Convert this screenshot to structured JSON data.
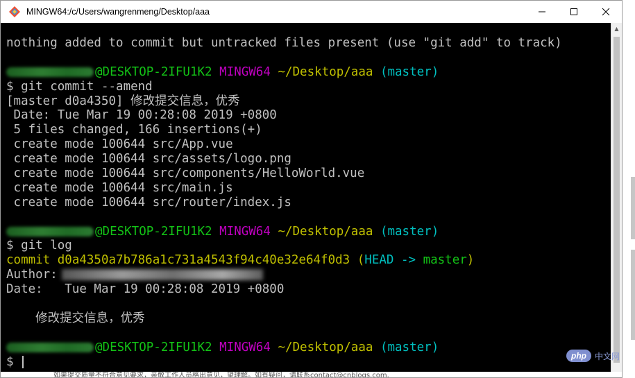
{
  "window": {
    "title": "MINGW64:/c/Users/wangrenmeng/Desktop/aaa"
  },
  "colors": {
    "host": "#13c216",
    "shell": "#c000c0",
    "path": "#c0c000",
    "branch": "#00c0c0",
    "text": "#c0c0c0",
    "commit": "#c0c000",
    "head": "#00c0c0",
    "master_ref": "#13c216"
  },
  "terminal": {
    "line1": "nothing added to commit but untracked files present (use \"git add\" to track)",
    "prompt": {
      "host": "@DESKTOP-2IFU1K2",
      "shell": "MINGW64",
      "path": "~/Desktop/aaa",
      "branch": "(master)"
    },
    "cmd1": "$ git commit --amend",
    "commit_out_prefix": "[master d0a4350] ",
    "commit_out_msg": "修改提交信息，优秀",
    "commit_date": " Date: Tue Mar 19 00:28:08 2019 +0800",
    "commit_stats": " 5 files changed, 166 insertions(+)",
    "create_lines": [
      " create mode 100644 src/App.vue",
      " create mode 100644 src/assets/logo.png",
      " create mode 100644 src/components/HelloWorld.vue",
      " create mode 100644 src/main.js",
      " create mode 100644 src/router/index.js"
    ],
    "cmd2": "$ git log",
    "log_commit": "commit d0a4350a7b786a1c731a4543f94c40e32e64f0d3 ",
    "log_open": "(",
    "log_head": "HEAD -> ",
    "log_master": "master",
    "log_close": ")",
    "log_author": "Author:",
    "log_date": "Date:   Tue Mar 19 00:28:08 2019 +0800",
    "log_msg": "修改提交信息，优秀",
    "final_prompt": "$ "
  },
  "background": {
    "logo_php": "php",
    "logo_cn": "中文网",
    "bottom_text": "如果提交质量不符合意见要求，亲敬工作人员格出意见，望理解。如有疑问，请联系contact@cnblogs.com."
  },
  "icons": {
    "app": "git-bash-icon",
    "minimize": "minimize-icon",
    "maximize": "maximize-icon",
    "close": "close-icon"
  }
}
